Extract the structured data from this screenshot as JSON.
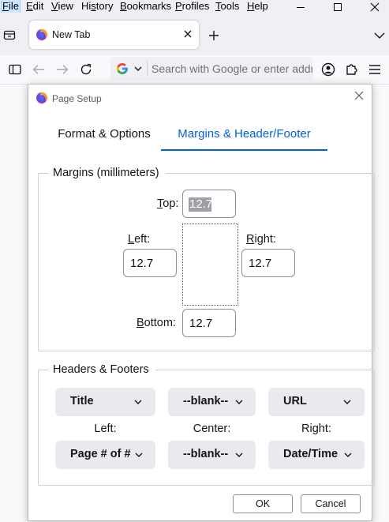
{
  "menubar": {
    "items": [
      {
        "label": "File",
        "accel": "F"
      },
      {
        "label": "Edit",
        "accel": "E"
      },
      {
        "label": "View",
        "accel": "V"
      },
      {
        "label": "History",
        "accel": "s"
      },
      {
        "label": "Bookmarks",
        "accel": "B"
      },
      {
        "label": "Profiles",
        "accel": "P"
      },
      {
        "label": "Tools",
        "accel": "T"
      },
      {
        "label": "Help",
        "accel": "H"
      }
    ]
  },
  "tabs": [
    {
      "title": "New Tab"
    }
  ],
  "urlbar": {
    "placeholder": "Search with Google or enter address"
  },
  "dialog": {
    "title": "Page Setup",
    "tabs": [
      "Format & Options",
      "Margins & Header/Footer"
    ],
    "selected_tab": "Margins & Header/Footer",
    "margins": {
      "legend": "Margins (millimeters)",
      "top_label": "Top:",
      "top_accel": "T",
      "top_value": "12.7",
      "left_label": "Left:",
      "left_accel": "L",
      "left_value": "12.7",
      "right_label": "Right:",
      "right_accel": "R",
      "right_value": "12.7",
      "bottom_label": "Bottom:",
      "bottom_accel": "B",
      "bottom_value": "12.7"
    },
    "headers_footers": {
      "legend": "Headers & Footers",
      "header": {
        "left": "Title",
        "center": "--blank--",
        "right": "URL"
      },
      "col_labels": {
        "left": "Left:",
        "center": "Center:",
        "right": "Right:"
      },
      "footer": {
        "left": "Page # of #",
        "center": "--blank--",
        "right": "Date/Time"
      }
    },
    "ok_label": "OK",
    "cancel_label": "Cancel"
  },
  "colors": {
    "accent": "#0061e0",
    "selection": "#9f9fa5"
  }
}
